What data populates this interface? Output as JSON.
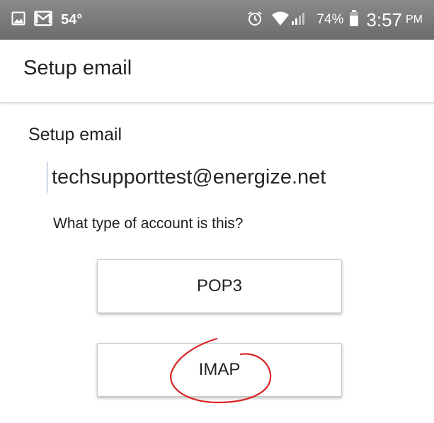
{
  "status_bar": {
    "notification_icons": [
      "gallery-icon",
      "mail-icon"
    ],
    "temperature": "54°",
    "system_icons": [
      "alarm-icon",
      "wifi-icon",
      "signal-icon"
    ],
    "battery_percent": "74%",
    "battery_level": 0.74,
    "time": "3:57",
    "ampm": "PM"
  },
  "app_bar": {
    "title": "Setup email"
  },
  "main": {
    "section_title": "Setup email",
    "email_value": "techsupporttest@energize.net",
    "question": "What type of account is this?",
    "options": [
      {
        "label": "POP3"
      },
      {
        "label": "IMAP"
      }
    ],
    "annotation_color": "#d92222"
  }
}
